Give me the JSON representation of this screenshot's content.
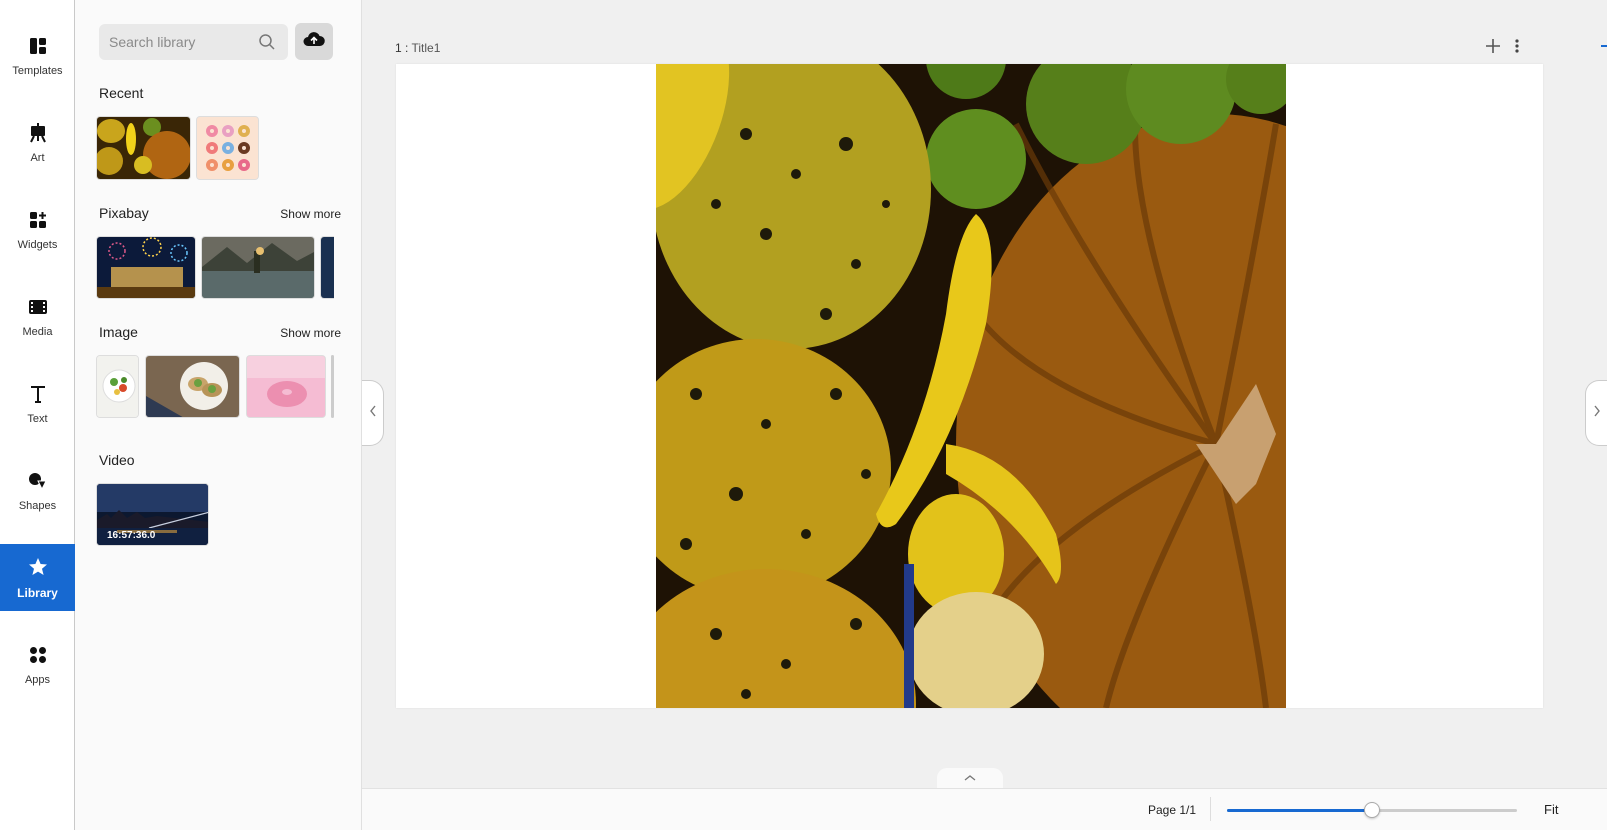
{
  "rail": {
    "items": [
      {
        "label": "Templates",
        "icon": "templates-icon"
      },
      {
        "label": "Art",
        "icon": "easel-icon"
      },
      {
        "label": "Widgets",
        "icon": "widgets-icon"
      },
      {
        "label": "Media",
        "icon": "film-icon"
      },
      {
        "label": "Text",
        "icon": "text-icon"
      },
      {
        "label": "Shapes",
        "icon": "shapes-icon"
      },
      {
        "label": "Library",
        "icon": "star-icon",
        "active": true
      },
      {
        "label": "Apps",
        "icon": "apps-icon"
      }
    ]
  },
  "library": {
    "search_placeholder": "Search library",
    "recent_title": "Recent",
    "pixabay_title": "Pixabay",
    "image_title": "Image",
    "video_title": "Video",
    "show_more": "Show more",
    "video_duration": "16:57:36.0"
  },
  "editor": {
    "page_number": "1 :",
    "page_title": "Title1",
    "page_count": "Page 1/1",
    "fit_label": "Fit",
    "zoom_fraction": 0.5
  },
  "colors": {
    "accent": "#1769d1",
    "rail_bg": "#ffffff",
    "canvas_bg": "#ffffff",
    "workspace_bg": "#f0f0f0"
  }
}
